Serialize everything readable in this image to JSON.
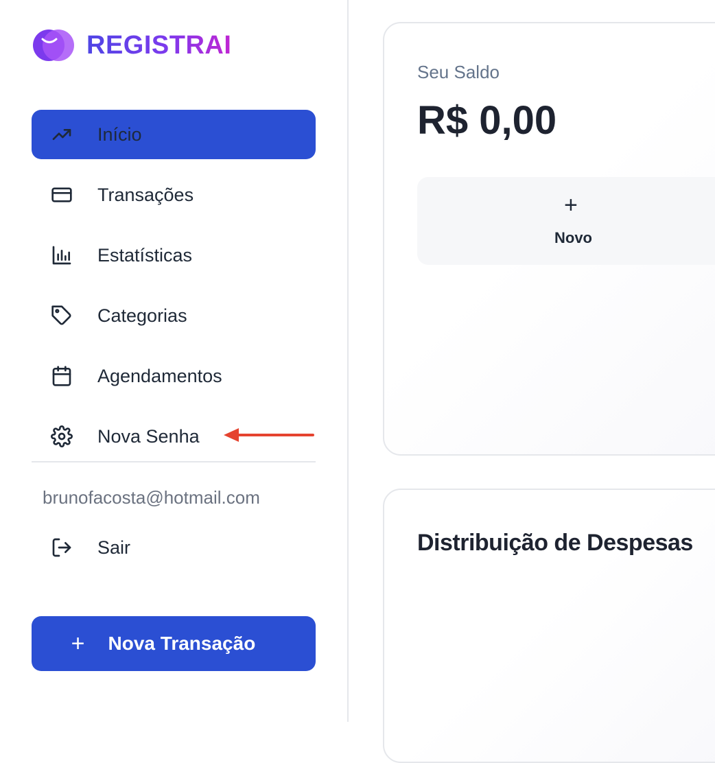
{
  "brand": {
    "name": "REGISTRAI"
  },
  "sidebar": {
    "items": [
      {
        "label": "Início",
        "icon": "trending-up-icon",
        "active": true
      },
      {
        "label": "Transações",
        "icon": "credit-card-icon",
        "active": false
      },
      {
        "label": "Estatísticas",
        "icon": "bar-chart-icon",
        "active": false
      },
      {
        "label": "Categorias",
        "icon": "tag-icon",
        "active": false
      },
      {
        "label": "Agendamentos",
        "icon": "calendar-icon",
        "active": false
      },
      {
        "label": "Nova Senha",
        "icon": "gear-icon",
        "active": false
      }
    ],
    "user_email": "brunofacosta@hotmail.com",
    "logout_label": "Sair",
    "new_transaction_label": "Nova Transação"
  },
  "balance": {
    "label": "Seu Saldo",
    "value": "R$ 0,00",
    "new_label": "Novo"
  },
  "distribution": {
    "title": "Distribuição de Despesas"
  },
  "colors": {
    "accent": "#2b4fd3",
    "annotation_arrow": "#e5432f"
  }
}
